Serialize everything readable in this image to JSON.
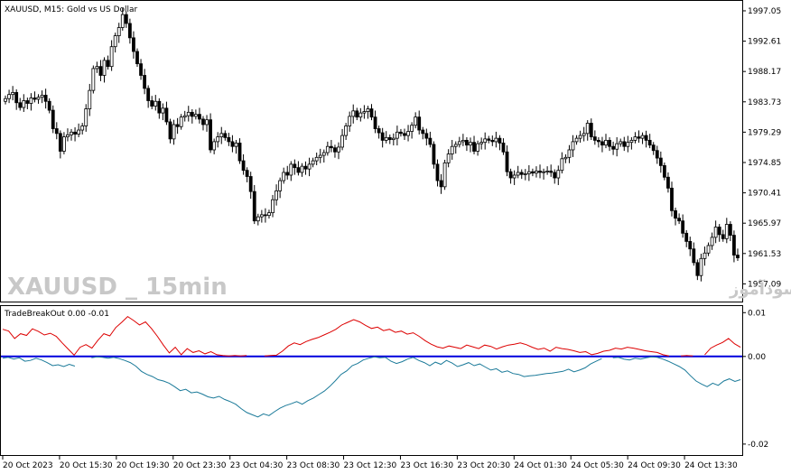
{
  "window": {
    "title": "XAUUSD, M15:  Gold vs US Dollar",
    "watermark_symbol": "XAUUSD _ 15min",
    "watermark_text": "انتشار در سایت سودآموز",
    "indicator_title": "TradeBreakOut 0.00 -0.01"
  },
  "colors": {
    "candle": "#000000",
    "indicator_up": "#dd0000",
    "indicator_down": "#1b7a99",
    "zero_line": "#0000dd",
    "grid": "#000000"
  },
  "chart_data": [
    {
      "type": "candlestick",
      "title": "XAUUSD, M15:  Gold vs US Dollar",
      "y_ticks": [
        "1997.05",
        "1992.61",
        "1988.17",
        "1983.73",
        "1979.29",
        "1974.85",
        "1970.41",
        "1965.97",
        "1961.53",
        "1957.09"
      ],
      "ylim": [
        1954.5,
        1998.5
      ],
      "x_ticks": [
        "20 Oct 2023",
        "20 Oct 15:30",
        "20 Oct 19:30",
        "20 Oct 23:30",
        "23 Oct 04:30",
        "23 Oct 08:30",
        "23 Oct 12:30",
        "23 Oct 16:30",
        "23 Oct 20:30",
        "24 Oct 01:30",
        "24 Oct 05:30",
        "24 Oct 09:30",
        "24 Oct 13:30"
      ],
      "close": [
        1984.2,
        1984.8,
        1985.1,
        1983.6,
        1982.9,
        1983.9,
        1983.5,
        1984.3,
        1984.1,
        1984.4,
        1984.7,
        1983.8,
        1982.5,
        1979.8,
        1979.1,
        1976.5,
        1978.6,
        1978.9,
        1979.3,
        1979.0,
        1979.6,
        1980.2,
        1982.7,
        1985.4,
        1988.6,
        1988.9,
        1987.6,
        1989.8,
        1988.9,
        1991.8,
        1993.4,
        1994.6,
        1996.5,
        1995.2,
        1993.1,
        1991.1,
        1989.3,
        1987.6,
        1985.7,
        1983.9,
        1983.1,
        1983.8,
        1982.1,
        1982.8,
        1980.8,
        1978.3,
        1980.4,
        1980.1,
        1981.5,
        1981.7,
        1982.2,
        1981.6,
        1981.9,
        1981.2,
        1980.4,
        1981.1,
        1976.7,
        1977.9,
        1978.6,
        1979.1,
        1978.5,
        1977.9,
        1977.2,
        1977.7,
        1975.1,
        1973.7,
        1972.8,
        1970.6,
        1966.3,
        1966.9,
        1967.2,
        1967.1,
        1967.5,
        1969.4,
        1970.7,
        1972.2,
        1973.4,
        1973.0,
        1974.6,
        1974.1,
        1973.4,
        1974.3,
        1973.9,
        1974.6,
        1975.1,
        1975.6,
        1975.9,
        1976.3,
        1977.2,
        1977.0,
        1976.4,
        1977.1,
        1978.8,
        1980.2,
        1981.6,
        1982.4,
        1981.5,
        1982.1,
        1982.3,
        1982.7,
        1981.5,
        1979.8,
        1979.2,
        1978.1,
        1978.5,
        1978.2,
        1978.4,
        1979.3,
        1979.1,
        1978.8,
        1979.4,
        1980.3,
        1981.5,
        1979.6,
        1979.1,
        1978.4,
        1977.5,
        1974.6,
        1972.2,
        1971.3,
        1974.8,
        1976.1,
        1977.2,
        1977.5,
        1977.9,
        1978.1,
        1977.4,
        1977.8,
        1976.5,
        1977.6,
        1977.8,
        1978.3,
        1978.1,
        1977.9,
        1978.4,
        1977.7,
        1976.4,
        1973.5,
        1972.6,
        1973.0,
        1973.4,
        1973.1,
        1973.2,
        1973.5,
        1973.3,
        1973.6,
        1973.4,
        1973.5,
        1973.6,
        1973.4,
        1972.6,
        1973.7,
        1975.4,
        1975.6,
        1976.7,
        1977.9,
        1978.4,
        1978.8,
        1979.1,
        1980.6,
        1978.6,
        1978.1,
        1977.9,
        1977.4,
        1978.1,
        1977.2,
        1976.8,
        1977.6,
        1977.9,
        1977.2,
        1977.8,
        1978.1,
        1978.6,
        1978.4,
        1978.8,
        1978.1,
        1977.4,
        1976.6,
        1975.5,
        1974.4,
        1972.7,
        1971.1,
        1967.8,
        1966.7,
        1966.3,
        1964.5,
        1963.3,
        1962.2,
        1960.2,
        1958.3,
        1960.8,
        1961.6,
        1962.7,
        1963.9,
        1965.4,
        1964.3,
        1963.7,
        1965.8,
        1964.2,
        1961.3,
        1960.9
      ]
    },
    {
      "type": "line",
      "title": "TradeBreakOut 0.00 -0.01",
      "y_ticks": [
        "0.01",
        "0.00",
        "-0.02"
      ],
      "ylim": [
        -0.0225,
        0.0115
      ],
      "series": [
        {
          "color": "#dd0000",
          "values": [
            0.0062,
            0.0058,
            0.0041,
            0.0052,
            0.0048,
            0.0063,
            0.0057,
            0.0049,
            0.0053,
            0.0046,
            0.0031,
            0.0017,
            0.0003,
            0.0021,
            0.0027,
            0.0019,
            0.0037,
            0.0052,
            0.0047,
            0.0066,
            0.0078,
            0.0091,
            0.0082,
            0.0072,
            0.0079,
            0.0064,
            0.0046,
            0.0026,
            0.0008,
            0.0021,
            0.0004,
            0.0018,
            0.0009,
            0.0013,
            0.0006,
            0.0011,
            0.0004,
            0.0002,
            0.0001,
            0.0002,
            0.0001,
            0.0002,
            null,
            null,
            0.0001,
            0.0002,
            0.0003,
            0.0012,
            0.0024,
            0.0031,
            0.0027,
            0.0034,
            0.0039,
            0.0043,
            0.0049,
            0.0055,
            0.0062,
            0.0072,
            0.0078,
            0.0084,
            0.0079,
            0.0071,
            0.0064,
            0.0067,
            0.0059,
            0.0062,
            0.0055,
            0.0058,
            0.0051,
            0.0054,
            0.0046,
            0.0036,
            0.0028,
            0.0022,
            0.0019,
            0.0024,
            0.0021,
            0.0018,
            0.0026,
            0.0022,
            0.0018,
            0.0026,
            0.0023,
            0.0017,
            0.0022,
            0.0026,
            0.0028,
            0.0031,
            0.0027,
            0.0021,
            0.0016,
            0.0019,
            0.0012,
            0.0021,
            0.0018,
            0.0016,
            0.0013,
            0.0009,
            0.0011,
            0.0004,
            0.0007,
            0.0012,
            0.0014,
            0.0019,
            0.0017,
            0.0021,
            0.0019,
            0.0016,
            0.0013,
            0.0011,
            0.0009,
            0.0004,
            0.0001,
            null,
            0.0001,
            0.0002,
            0.0001,
            null,
            0.0004,
            0.0019,
            0.0026,
            0.0032,
            0.0041,
            0.0029,
            0.0021
          ]
        },
        {
          "color": "#1b7a99",
          "values": [
            -0.0004,
            -0.0002,
            -0.0006,
            -0.0003,
            -0.0011,
            -0.0009,
            -0.0004,
            -0.0008,
            -0.0014,
            -0.0021,
            -0.0019,
            -0.0023,
            -0.0018,
            -0.0022,
            null,
            null,
            -0.0003,
            -0.0001,
            -0.0002,
            -0.0004,
            -0.0002,
            -0.0005,
            -0.0009,
            -0.0014,
            -0.0022,
            -0.0034,
            -0.0041,
            -0.0046,
            -0.0053,
            -0.0056,
            -0.0061,
            -0.0069,
            -0.0078,
            -0.0075,
            -0.0083,
            -0.0081,
            -0.0086,
            -0.0092,
            -0.0095,
            -0.0091,
            -0.0098,
            -0.0103,
            -0.0109,
            -0.0119,
            -0.0128,
            -0.0133,
            -0.0138,
            -0.0131,
            -0.0135,
            -0.0126,
            -0.0118,
            -0.0112,
            -0.0108,
            -0.0103,
            -0.0109,
            -0.0101,
            -0.0095,
            -0.0087,
            -0.0079,
            -0.0068,
            -0.0055,
            -0.0041,
            -0.0033,
            -0.0021,
            -0.0016,
            -0.0008,
            -0.0004,
            -0.0001,
            -0.0003,
            -0.0002,
            -0.0011,
            -0.0016,
            -0.0012,
            -0.0006,
            -0.0002,
            -0.0009,
            -0.0014,
            -0.0021,
            -0.0013,
            -0.0018,
            -0.0009,
            -0.0015,
            -0.0023,
            -0.0019,
            -0.0014,
            -0.0021,
            -0.0017,
            -0.0024,
            -0.0031,
            -0.0028,
            -0.0036,
            -0.0033,
            -0.0039,
            -0.0041,
            -0.0046,
            -0.0044,
            -0.0043,
            -0.0041,
            -0.0039,
            -0.0038,
            -0.0036,
            -0.0034,
            -0.0029,
            -0.0035,
            -0.0031,
            -0.0026,
            -0.0017,
            -0.0011,
            -0.0005,
            null,
            -0.0003,
            -0.0002,
            -0.0006,
            -0.0008,
            -0.0004,
            -0.0006,
            -0.0003,
            -0.0001,
            -0.0002,
            -0.0006,
            -0.0011,
            -0.0017,
            -0.0023,
            -0.0031,
            -0.0044,
            -0.0056,
            -0.0063,
            -0.0069,
            -0.0061,
            -0.0066,
            -0.0056,
            -0.0051,
            -0.0057,
            -0.0053
          ]
        }
      ],
      "reference_lines": [
        {
          "y": 0,
          "color": "#0000dd"
        }
      ]
    }
  ]
}
